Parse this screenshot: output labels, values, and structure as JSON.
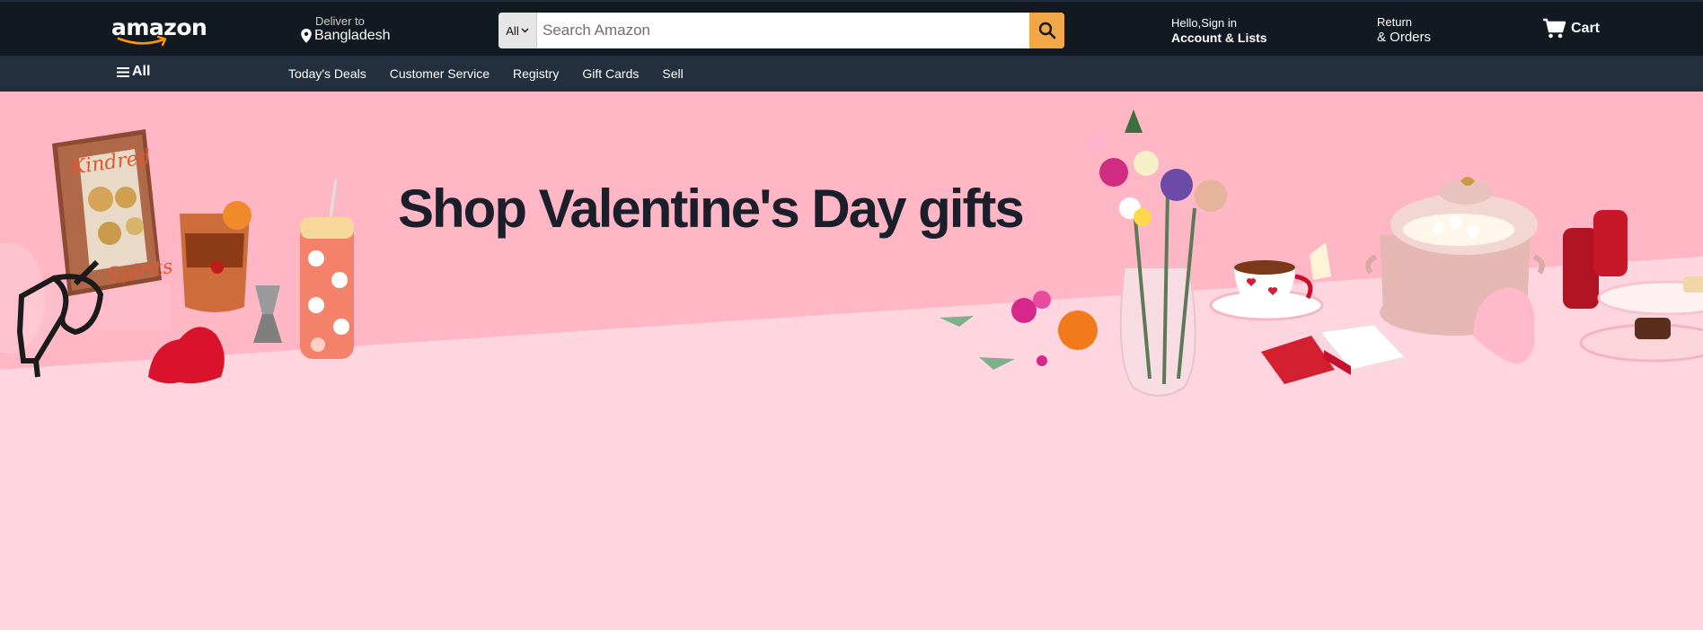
{
  "header": {
    "logo_text": "amazon",
    "deliver_label": "Deliver to",
    "deliver_location": "Bangladesh",
    "search": {
      "category": "All",
      "placeholder": "Search Amazon"
    },
    "account_line1": "Hello,Sign in",
    "account_line2": "Account & Lists",
    "orders_line1": "Return",
    "orders_line2": "& Orders",
    "cart_label": "Cart"
  },
  "subnav": {
    "all_label": "All",
    "links": [
      "Today's Deals",
      "Customer Service",
      "Registry",
      "Gift Cards",
      "Sell"
    ]
  },
  "hero": {
    "title": "Shop Valentine's Day gifts",
    "book_title": "Kindred Spirits"
  },
  "colors": {
    "nav_top": "#131921",
    "nav_sub": "#232f3e",
    "search_button": "#f3a847",
    "hero_wall": "#ffb7c6",
    "hero_table": "#ffd6e0",
    "title_text": "#1a1f2b"
  },
  "icons": {
    "logo": "amazon-smile-icon",
    "location": "map-pin-icon",
    "search": "magnifier-icon",
    "cart": "shopping-cart-icon",
    "menu": "hamburger-icon"
  }
}
